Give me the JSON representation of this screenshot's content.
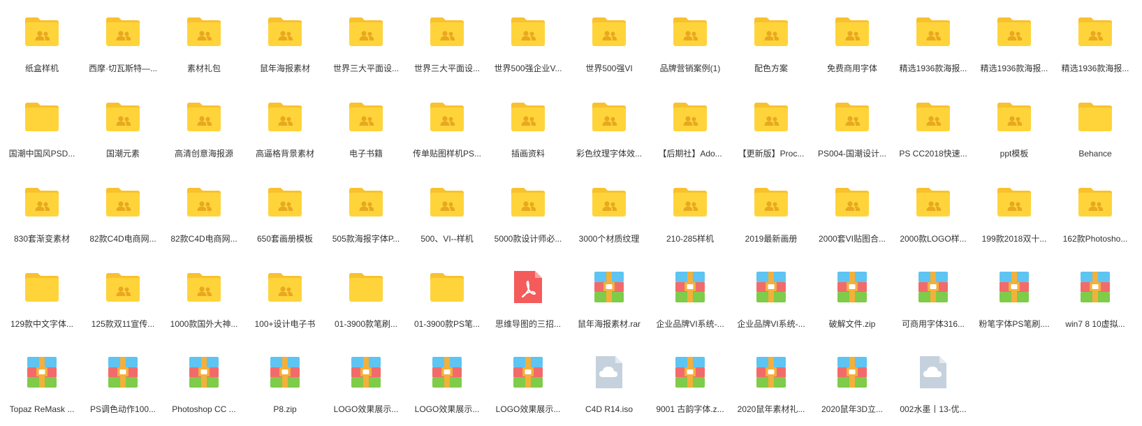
{
  "colors": {
    "folder_back": "#F9C12E",
    "folder_front": "#FFD43B",
    "folder_people": "#E8A820",
    "pdf": "#F45B5B",
    "archive_top": "#5EC4F2",
    "archive_mid": "#F26B6B",
    "archive_bottom": "#7FCB4A",
    "archive_strap": "#F3B03A",
    "cloud_file": "#C5D2DD"
  },
  "files": [
    {
      "name": "纸盒样机",
      "icon": "shared-folder-icon",
      "type": "folder"
    },
    {
      "name": "西摩·切瓦斯特—...",
      "icon": "shared-folder-icon",
      "type": "folder"
    },
    {
      "name": "素材礼包",
      "icon": "shared-folder-icon",
      "type": "folder"
    },
    {
      "name": "鼠年海报素材",
      "icon": "shared-folder-icon",
      "type": "folder"
    },
    {
      "name": "世界三大平面设...",
      "icon": "shared-folder-icon",
      "type": "folder"
    },
    {
      "name": "世界三大平面设...",
      "icon": "shared-folder-icon",
      "type": "folder"
    },
    {
      "name": "世界500强企业V...",
      "icon": "shared-folder-icon",
      "type": "folder"
    },
    {
      "name": "世界500强VI",
      "icon": "shared-folder-icon",
      "type": "folder"
    },
    {
      "name": "品牌营销案例(1)",
      "icon": "shared-folder-icon",
      "type": "folder"
    },
    {
      "name": "配色方案",
      "icon": "shared-folder-icon",
      "type": "folder"
    },
    {
      "name": "免费商用字体",
      "icon": "shared-folder-icon",
      "type": "folder"
    },
    {
      "name": "精选1936款海报...",
      "icon": "shared-folder-icon",
      "type": "folder"
    },
    {
      "name": "精选1936款海报...",
      "icon": "shared-folder-icon",
      "type": "folder"
    },
    {
      "name": "精选1936款海报...",
      "icon": "shared-folder-icon",
      "type": "folder"
    },
    {
      "name": "国潮中国风PSD...",
      "icon": "folder-icon",
      "type": "folder"
    },
    {
      "name": "国潮元素",
      "icon": "shared-folder-icon",
      "type": "folder"
    },
    {
      "name": "高清创意海报源",
      "icon": "shared-folder-icon",
      "type": "folder"
    },
    {
      "name": "高逼格背景素材",
      "icon": "shared-folder-icon",
      "type": "folder"
    },
    {
      "name": "电子书籍",
      "icon": "shared-folder-icon",
      "type": "folder"
    },
    {
      "name": "传单贴图样机PS...",
      "icon": "shared-folder-icon",
      "type": "folder"
    },
    {
      "name": "插画资料",
      "icon": "shared-folder-icon",
      "type": "folder"
    },
    {
      "name": "彩色纹理字体效...",
      "icon": "shared-folder-icon",
      "type": "folder"
    },
    {
      "name": "【后期社】Ado...",
      "icon": "shared-folder-icon",
      "type": "folder"
    },
    {
      "name": "【更新版】Proc...",
      "icon": "shared-folder-icon",
      "type": "folder"
    },
    {
      "name": "PS004-国潮设计...",
      "icon": "shared-folder-icon",
      "type": "folder"
    },
    {
      "name": "PS CC2018快速...",
      "icon": "shared-folder-icon",
      "type": "folder"
    },
    {
      "name": "ppt模板",
      "icon": "shared-folder-icon",
      "type": "folder"
    },
    {
      "name": "Behance",
      "icon": "folder-icon",
      "type": "folder"
    },
    {
      "name": "830套渐变素材",
      "icon": "shared-folder-icon",
      "type": "folder"
    },
    {
      "name": "82款C4D电商网...",
      "icon": "shared-folder-icon",
      "type": "folder"
    },
    {
      "name": "82款C4D电商网...",
      "icon": "shared-folder-icon",
      "type": "folder"
    },
    {
      "name": "650套画册模板",
      "icon": "shared-folder-icon",
      "type": "folder"
    },
    {
      "name": "505款海报字体P...",
      "icon": "shared-folder-icon",
      "type": "folder"
    },
    {
      "name": "500、VI--样机",
      "icon": "shared-folder-icon",
      "type": "folder"
    },
    {
      "name": "5000款设计师必...",
      "icon": "shared-folder-icon",
      "type": "folder"
    },
    {
      "name": "3000个材质纹理",
      "icon": "shared-folder-icon",
      "type": "folder"
    },
    {
      "name": "210-285样机",
      "icon": "shared-folder-icon",
      "type": "folder"
    },
    {
      "name": "2019最新画册",
      "icon": "shared-folder-icon",
      "type": "folder"
    },
    {
      "name": "2000套VI贴图合...",
      "icon": "shared-folder-icon",
      "type": "folder"
    },
    {
      "name": "2000款LOGO样...",
      "icon": "shared-folder-icon",
      "type": "folder"
    },
    {
      "name": "199款2018双十...",
      "icon": "shared-folder-icon",
      "type": "folder"
    },
    {
      "name": "162款Photosho...",
      "icon": "shared-folder-icon",
      "type": "folder"
    },
    {
      "name": "129款中文字体...",
      "icon": "folder-icon",
      "type": "folder"
    },
    {
      "name": "125款双11宣传...",
      "icon": "shared-folder-icon",
      "type": "folder"
    },
    {
      "name": "1000款国外大神...",
      "icon": "shared-folder-icon",
      "type": "folder"
    },
    {
      "name": "100+设计电子书",
      "icon": "shared-folder-icon",
      "type": "folder"
    },
    {
      "name": "01-3900款笔刷...",
      "icon": "folder-icon",
      "type": "folder"
    },
    {
      "name": "01-3900款PS笔...",
      "icon": "folder-icon",
      "type": "folder"
    },
    {
      "name": "思维导图的三招...",
      "icon": "pdf-icon",
      "type": "pdf"
    },
    {
      "name": "鼠年海报素材.rar",
      "icon": "archive-icon",
      "type": "archive"
    },
    {
      "name": "企业品牌VI系统-...",
      "icon": "archive-icon",
      "type": "archive"
    },
    {
      "name": "企业品牌VI系统-...",
      "icon": "archive-icon",
      "type": "archive"
    },
    {
      "name": "破解文件.zip",
      "icon": "archive-icon",
      "type": "archive"
    },
    {
      "name": "可商用字体316...",
      "icon": "archive-icon",
      "type": "archive"
    },
    {
      "name": "粉笔字体PS笔刷....",
      "icon": "archive-icon",
      "type": "archive"
    },
    {
      "name": "win7 8 10虚拟...",
      "icon": "archive-icon",
      "type": "archive"
    },
    {
      "name": "Topaz ReMask ...",
      "icon": "archive-icon",
      "type": "archive"
    },
    {
      "name": "PS调色动作100...",
      "icon": "archive-icon",
      "type": "archive"
    },
    {
      "name": "Photoshop CC ...",
      "icon": "archive-icon",
      "type": "archive"
    },
    {
      "name": "P8.zip",
      "icon": "archive-icon",
      "type": "archive"
    },
    {
      "name": "LOGO效果展示...",
      "icon": "archive-icon",
      "type": "archive"
    },
    {
      "name": "LOGO效果展示...",
      "icon": "archive-icon",
      "type": "archive"
    },
    {
      "name": "LOGO效果展示...",
      "icon": "archive-icon",
      "type": "archive"
    },
    {
      "name": "C4D R14.iso",
      "icon": "cloud-file-icon",
      "type": "iso"
    },
    {
      "name": "9001 古韵字体.z...",
      "icon": "archive-icon",
      "type": "archive"
    },
    {
      "name": "2020鼠年素材礼...",
      "icon": "archive-icon",
      "type": "archive"
    },
    {
      "name": "2020鼠年3D立...",
      "icon": "archive-icon",
      "type": "archive"
    },
    {
      "name": "002水墨丨13-优...",
      "icon": "cloud-file-icon",
      "type": "unknown"
    }
  ]
}
